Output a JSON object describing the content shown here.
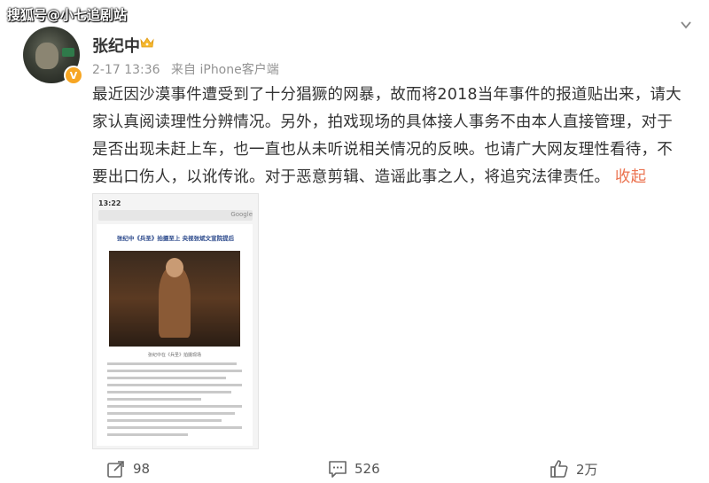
{
  "watermark": "搜狐号@小七追剧站",
  "user": {
    "name": "张纪中",
    "avatar": "avatar",
    "verified": "V",
    "badge_icon": "crown-icon"
  },
  "meta": {
    "time": "2-17 13:36",
    "source": "来自 iPhone客户端"
  },
  "post": {
    "text": "最近因沙漠事件遭受到了十分猖獗的网暴，故而将2018当年事件的报道贴出来，请大家认真阅读理性分辨情况。另外，拍戏现场的具体接人事务不由本人直接管理，对于是否出现未赶上车，也一直也从未听说相关情况的反映。也请广大网友理性看待，不要出口伤人，以讹传讹。对于恶意剪辑、造谣此事之人，将追究法律责任。",
    "collapse_label": "收起"
  },
  "media": {
    "status_time": "13:22",
    "browser_label": "Google",
    "article_title": "张纪中《兵圣》拍摄至上 央视张斌文宣院提后",
    "photo_caption": "张纪中在《兵圣》拍摄现场"
  },
  "actions": {
    "share_count": "98",
    "comment_count": "526",
    "like_count": "2万"
  },
  "colors": {
    "link": "#eb7350",
    "meta": "#939393",
    "text": "#333333"
  }
}
